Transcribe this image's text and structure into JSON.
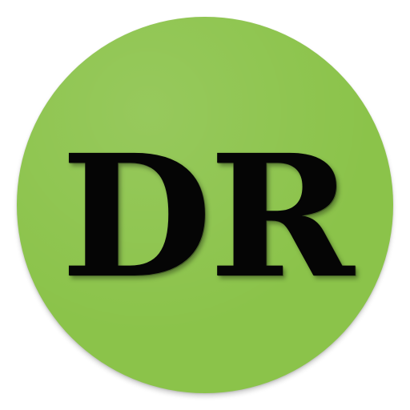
{
  "icon": {
    "label": "DR",
    "background_color": "#8bc34a",
    "text_color": "#050505",
    "shape": "circle"
  }
}
